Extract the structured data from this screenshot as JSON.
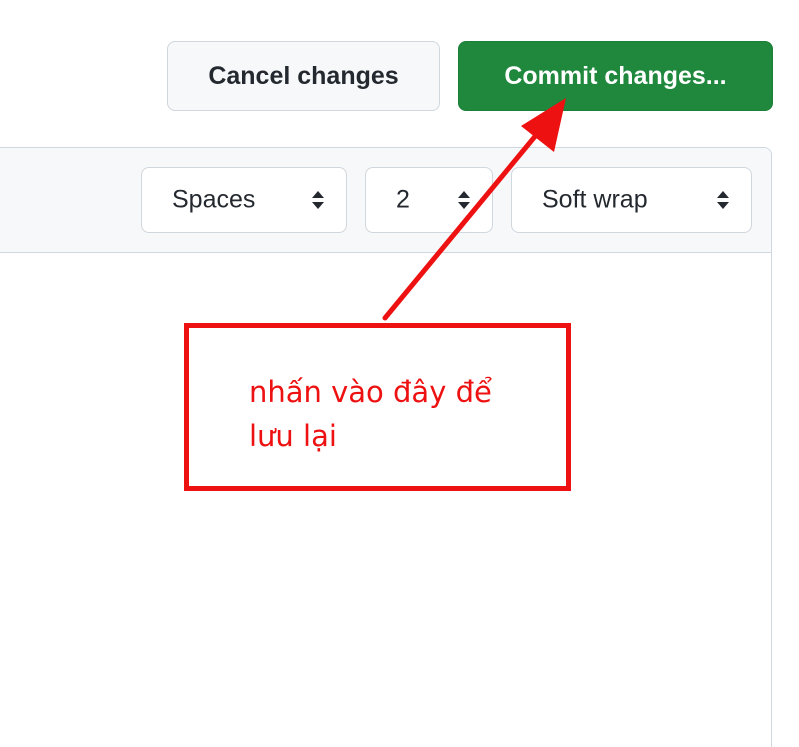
{
  "actions": {
    "cancel_label": "Cancel changes",
    "commit_label": "Commit changes..."
  },
  "toolbar": {
    "indent_mode": {
      "selected": "Spaces",
      "caret_icon": "select-caret-icon"
    },
    "indent_size": {
      "selected": "2",
      "caret_icon": "select-caret-icon"
    },
    "wrap_mode": {
      "selected": "Soft wrap",
      "caret_icon": "select-caret-icon"
    }
  },
  "annotation": {
    "text": "nhấn vào đây để\nlưu lại",
    "color": "#ee1111"
  },
  "colors": {
    "commit_bg": "#1f883d",
    "cancel_bg": "#f6f8fa",
    "border": "#d0d7de",
    "toolbar_bg": "#f6f8fa"
  }
}
